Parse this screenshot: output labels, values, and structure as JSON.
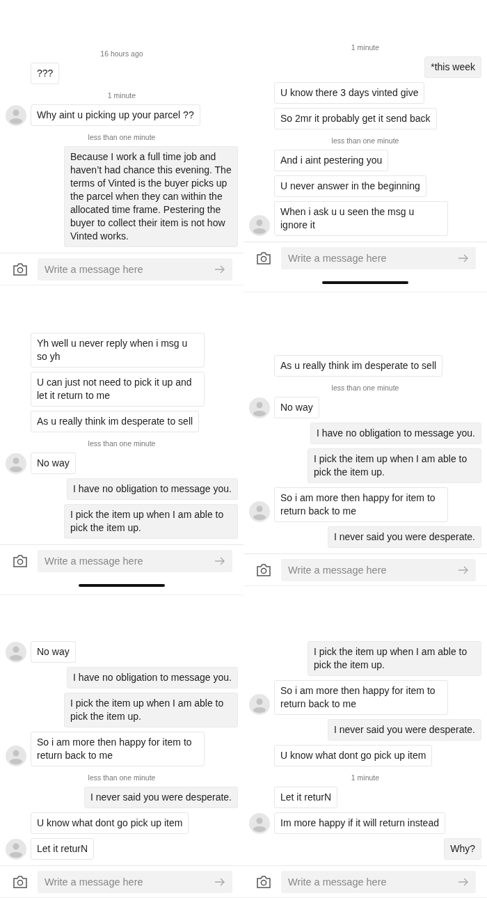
{
  "panels": [
    {
      "home_indicator": false,
      "composer": {
        "placeholder": "Write a message here"
      },
      "messages": [
        {
          "kind": "time",
          "text": "16 hours ago"
        },
        {
          "kind": "incoming",
          "text": "???",
          "avatar": false
        },
        {
          "kind": "time",
          "text": "1 minute"
        },
        {
          "kind": "incoming",
          "text": "Why aint u picking up your parcel ??",
          "avatar": true
        },
        {
          "kind": "time",
          "text": "less than one minute"
        },
        {
          "kind": "outgoing",
          "text": "Because I work a full time job and haven’t had chance this evening. The terms of Vinted is the buyer picks up the parcel when they can within the allocated time frame. Pestering the buyer to collect their item is not how Vinted works."
        }
      ]
    },
    {
      "home_indicator": true,
      "composer": {
        "placeholder": "Write a message here"
      },
      "messages": [
        {
          "kind": "incoming",
          "text": "Yh well u never reply when i msg u so yh",
          "avatar": false
        },
        {
          "kind": "incoming",
          "text": "U can just not need to pick it up and let it return to me",
          "avatar": false
        },
        {
          "kind": "incoming",
          "text": "As u really think im desperate to sell",
          "avatar": false
        },
        {
          "kind": "time",
          "text": "less than one minute"
        },
        {
          "kind": "incoming",
          "text": "No way",
          "avatar": true
        },
        {
          "kind": "outgoing",
          "text": "I have no obligation to message you."
        },
        {
          "kind": "outgoing",
          "text": "I pick the item up when I am able to pick the item up."
        }
      ]
    },
    {
      "home_indicator": false,
      "composer": {
        "placeholder": "Write a message here"
      },
      "messages": [
        {
          "kind": "incoming",
          "text": "No way",
          "avatar": true
        },
        {
          "kind": "outgoing",
          "text": "I have no obligation to message you."
        },
        {
          "kind": "outgoing",
          "text": "I pick the item up when I am able to pick the item up."
        },
        {
          "kind": "incoming",
          "text": "So i am more then happy for item to return back to me",
          "avatar": true
        },
        {
          "kind": "time",
          "text": "less than one minute"
        },
        {
          "kind": "outgoing",
          "text": "I never said you were desperate."
        },
        {
          "kind": "incoming",
          "text": "U know what dont go pick up item",
          "avatar": false
        },
        {
          "kind": "incoming",
          "text": "Let it returN",
          "avatar": true
        }
      ]
    },
    {
      "home_indicator": true,
      "composer": {
        "placeholder": "Write a message here"
      },
      "messages": [
        {
          "kind": "time",
          "text": "1 minute"
        },
        {
          "kind": "outgoing",
          "text": "*this week"
        },
        {
          "kind": "incoming",
          "text": "U know there 3 days vinted give",
          "avatar": false
        },
        {
          "kind": "incoming",
          "text": "So 2mr it probably get it send back",
          "avatar": false
        },
        {
          "kind": "time",
          "text": "less than one minute"
        },
        {
          "kind": "incoming",
          "text": "And i aint pestering you",
          "avatar": false
        },
        {
          "kind": "incoming",
          "text": "U never answer in the beginning",
          "avatar": false
        },
        {
          "kind": "incoming",
          "text": "When i ask u u seen the msg u ignore it",
          "avatar": true
        }
      ]
    },
    {
      "home_indicator": false,
      "composer": {
        "placeholder": "Write a message here"
      },
      "messages": [
        {
          "kind": "incoming",
          "text": "As u really think im desperate to sell",
          "avatar": false
        },
        {
          "kind": "time",
          "text": "less than one minute"
        },
        {
          "kind": "incoming",
          "text": "No way",
          "avatar": true
        },
        {
          "kind": "outgoing",
          "text": "I have no obligation to message you."
        },
        {
          "kind": "outgoing",
          "text": "I pick the item up when I am able to pick the item up."
        },
        {
          "kind": "incoming",
          "text": "So i am more then happy for item to return back to me",
          "avatar": true
        },
        {
          "kind": "outgoing",
          "text": "I never said you were desperate."
        }
      ]
    },
    {
      "home_indicator": false,
      "composer": {
        "placeholder": "Write a message here"
      },
      "messages": [
        {
          "kind": "outgoing",
          "text": "I pick the item up when I am able to pick the item up."
        },
        {
          "kind": "incoming",
          "text": "So i am more then happy for item to return back to me",
          "avatar": true
        },
        {
          "kind": "outgoing",
          "text": "I never said you were desperate."
        },
        {
          "kind": "incoming",
          "text": "U know what dont go pick up item",
          "avatar": false
        },
        {
          "kind": "time",
          "text": "1 minute"
        },
        {
          "kind": "incoming",
          "text": "Let it returN",
          "avatar": false
        },
        {
          "kind": "incoming",
          "text": "Im more happy if it will return instead",
          "avatar": true
        },
        {
          "kind": "outgoing",
          "text": "Why?"
        }
      ]
    }
  ]
}
